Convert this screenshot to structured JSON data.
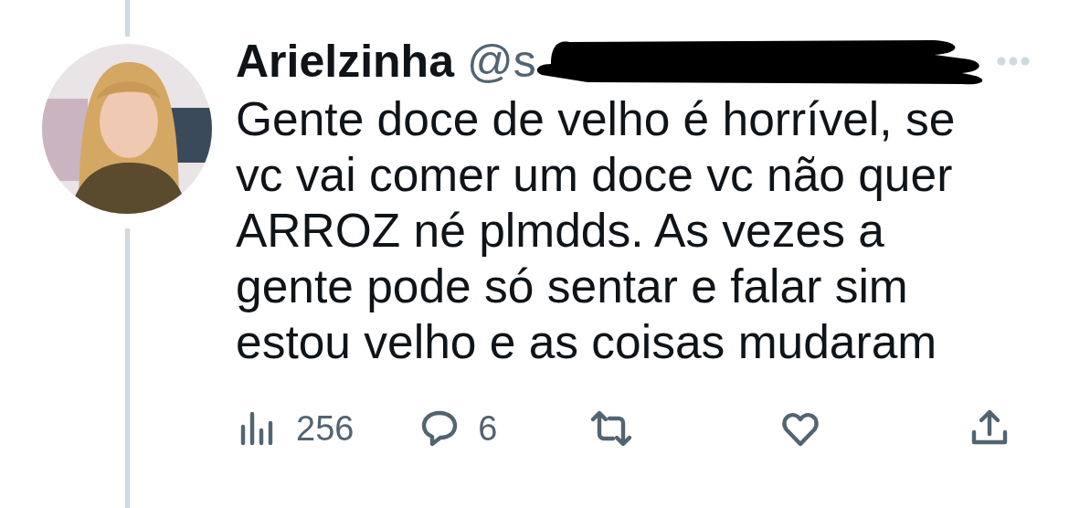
{
  "tweet": {
    "author": {
      "name": "Arielzinha",
      "handle": "@s",
      "handle_redacted": true
    },
    "text": "Gente doce de velho é horrível, se vc vai comer um doce vc não quer ARROZ né plmdds. As vezes a gente pode só sentar e falar sim estou velho e as coisas mudaram",
    "actions": [
      {
        "kind": "views",
        "count": "256"
      },
      {
        "kind": "reply",
        "count": "6"
      },
      {
        "kind": "retweet"
      },
      {
        "kind": "like"
      },
      {
        "kind": "share"
      }
    ]
  }
}
